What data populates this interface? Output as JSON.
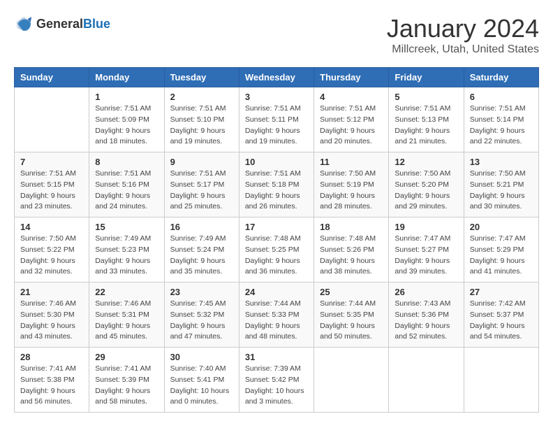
{
  "logo": {
    "text_general": "General",
    "text_blue": "Blue"
  },
  "title": {
    "month": "January 2024",
    "location": "Millcreek, Utah, United States"
  },
  "headers": [
    "Sunday",
    "Monday",
    "Tuesday",
    "Wednesday",
    "Thursday",
    "Friday",
    "Saturday"
  ],
  "weeks": [
    [
      {
        "day": "",
        "sunrise": "",
        "sunset": "",
        "daylight": ""
      },
      {
        "day": "1",
        "sunrise": "Sunrise: 7:51 AM",
        "sunset": "Sunset: 5:09 PM",
        "daylight": "Daylight: 9 hours and 18 minutes."
      },
      {
        "day": "2",
        "sunrise": "Sunrise: 7:51 AM",
        "sunset": "Sunset: 5:10 PM",
        "daylight": "Daylight: 9 hours and 19 minutes."
      },
      {
        "day": "3",
        "sunrise": "Sunrise: 7:51 AM",
        "sunset": "Sunset: 5:11 PM",
        "daylight": "Daylight: 9 hours and 19 minutes."
      },
      {
        "day": "4",
        "sunrise": "Sunrise: 7:51 AM",
        "sunset": "Sunset: 5:12 PM",
        "daylight": "Daylight: 9 hours and 20 minutes."
      },
      {
        "day": "5",
        "sunrise": "Sunrise: 7:51 AM",
        "sunset": "Sunset: 5:13 PM",
        "daylight": "Daylight: 9 hours and 21 minutes."
      },
      {
        "day": "6",
        "sunrise": "Sunrise: 7:51 AM",
        "sunset": "Sunset: 5:14 PM",
        "daylight": "Daylight: 9 hours and 22 minutes."
      }
    ],
    [
      {
        "day": "7",
        "sunrise": "Sunrise: 7:51 AM",
        "sunset": "Sunset: 5:15 PM",
        "daylight": "Daylight: 9 hours and 23 minutes."
      },
      {
        "day": "8",
        "sunrise": "Sunrise: 7:51 AM",
        "sunset": "Sunset: 5:16 PM",
        "daylight": "Daylight: 9 hours and 24 minutes."
      },
      {
        "day": "9",
        "sunrise": "Sunrise: 7:51 AM",
        "sunset": "Sunset: 5:17 PM",
        "daylight": "Daylight: 9 hours and 25 minutes."
      },
      {
        "day": "10",
        "sunrise": "Sunrise: 7:51 AM",
        "sunset": "Sunset: 5:18 PM",
        "daylight": "Daylight: 9 hours and 26 minutes."
      },
      {
        "day": "11",
        "sunrise": "Sunrise: 7:50 AM",
        "sunset": "Sunset: 5:19 PM",
        "daylight": "Daylight: 9 hours and 28 minutes."
      },
      {
        "day": "12",
        "sunrise": "Sunrise: 7:50 AM",
        "sunset": "Sunset: 5:20 PM",
        "daylight": "Daylight: 9 hours and 29 minutes."
      },
      {
        "day": "13",
        "sunrise": "Sunrise: 7:50 AM",
        "sunset": "Sunset: 5:21 PM",
        "daylight": "Daylight: 9 hours and 30 minutes."
      }
    ],
    [
      {
        "day": "14",
        "sunrise": "Sunrise: 7:50 AM",
        "sunset": "Sunset: 5:22 PM",
        "daylight": "Daylight: 9 hours and 32 minutes."
      },
      {
        "day": "15",
        "sunrise": "Sunrise: 7:49 AM",
        "sunset": "Sunset: 5:23 PM",
        "daylight": "Daylight: 9 hours and 33 minutes."
      },
      {
        "day": "16",
        "sunrise": "Sunrise: 7:49 AM",
        "sunset": "Sunset: 5:24 PM",
        "daylight": "Daylight: 9 hours and 35 minutes."
      },
      {
        "day": "17",
        "sunrise": "Sunrise: 7:48 AM",
        "sunset": "Sunset: 5:25 PM",
        "daylight": "Daylight: 9 hours and 36 minutes."
      },
      {
        "day": "18",
        "sunrise": "Sunrise: 7:48 AM",
        "sunset": "Sunset: 5:26 PM",
        "daylight": "Daylight: 9 hours and 38 minutes."
      },
      {
        "day": "19",
        "sunrise": "Sunrise: 7:47 AM",
        "sunset": "Sunset: 5:27 PM",
        "daylight": "Daylight: 9 hours and 39 minutes."
      },
      {
        "day": "20",
        "sunrise": "Sunrise: 7:47 AM",
        "sunset": "Sunset: 5:29 PM",
        "daylight": "Daylight: 9 hours and 41 minutes."
      }
    ],
    [
      {
        "day": "21",
        "sunrise": "Sunrise: 7:46 AM",
        "sunset": "Sunset: 5:30 PM",
        "daylight": "Daylight: 9 hours and 43 minutes."
      },
      {
        "day": "22",
        "sunrise": "Sunrise: 7:46 AM",
        "sunset": "Sunset: 5:31 PM",
        "daylight": "Daylight: 9 hours and 45 minutes."
      },
      {
        "day": "23",
        "sunrise": "Sunrise: 7:45 AM",
        "sunset": "Sunset: 5:32 PM",
        "daylight": "Daylight: 9 hours and 47 minutes."
      },
      {
        "day": "24",
        "sunrise": "Sunrise: 7:44 AM",
        "sunset": "Sunset: 5:33 PM",
        "daylight": "Daylight: 9 hours and 48 minutes."
      },
      {
        "day": "25",
        "sunrise": "Sunrise: 7:44 AM",
        "sunset": "Sunset: 5:35 PM",
        "daylight": "Daylight: 9 hours and 50 minutes."
      },
      {
        "day": "26",
        "sunrise": "Sunrise: 7:43 AM",
        "sunset": "Sunset: 5:36 PM",
        "daylight": "Daylight: 9 hours and 52 minutes."
      },
      {
        "day": "27",
        "sunrise": "Sunrise: 7:42 AM",
        "sunset": "Sunset: 5:37 PM",
        "daylight": "Daylight: 9 hours and 54 minutes."
      }
    ],
    [
      {
        "day": "28",
        "sunrise": "Sunrise: 7:41 AM",
        "sunset": "Sunset: 5:38 PM",
        "daylight": "Daylight: 9 hours and 56 minutes."
      },
      {
        "day": "29",
        "sunrise": "Sunrise: 7:41 AM",
        "sunset": "Sunset: 5:39 PM",
        "daylight": "Daylight: 9 hours and 58 minutes."
      },
      {
        "day": "30",
        "sunrise": "Sunrise: 7:40 AM",
        "sunset": "Sunset: 5:41 PM",
        "daylight": "Daylight: 10 hours and 0 minutes."
      },
      {
        "day": "31",
        "sunrise": "Sunrise: 7:39 AM",
        "sunset": "Sunset: 5:42 PM",
        "daylight": "Daylight: 10 hours and 3 minutes."
      },
      {
        "day": "",
        "sunrise": "",
        "sunset": "",
        "daylight": ""
      },
      {
        "day": "",
        "sunrise": "",
        "sunset": "",
        "daylight": ""
      },
      {
        "day": "",
        "sunrise": "",
        "sunset": "",
        "daylight": ""
      }
    ]
  ]
}
